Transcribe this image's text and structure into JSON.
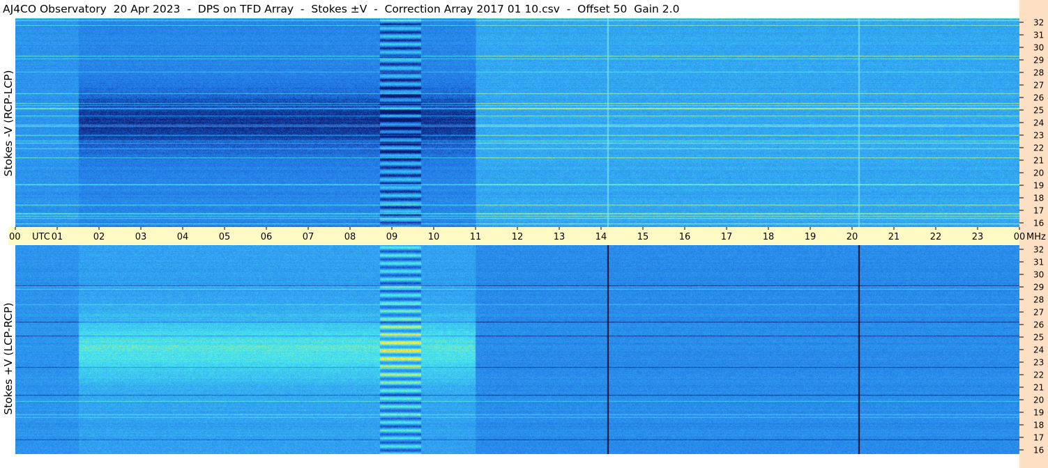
{
  "title": "AJ4CO Observatory  20 Apr 2023  -  DPS on TFD Array  -  Stokes ±V  -  Correction Array 2017 01 10.csv  -  Offset 50  Gain 2.0",
  "chart_data": [
    {
      "type": "heatmap",
      "panel": "top",
      "ylabel": "Stokes -V (RCP-LCP)",
      "x_ticks": [
        "00",
        "01",
        "02",
        "03",
        "04",
        "05",
        "06",
        "07",
        "08",
        "09",
        "10",
        "11",
        "12",
        "13",
        "14",
        "15",
        "16",
        "17",
        "18",
        "19",
        "20",
        "21",
        "22",
        "23",
        "00"
      ],
      "x_unit": "UTC",
      "xlim_hours": [
        0,
        24
      ],
      "y_ticks": [
        16,
        17,
        18,
        19,
        20,
        21,
        22,
        23,
        24,
        25,
        26,
        27,
        28,
        29,
        30,
        31,
        32
      ],
      "y_unit": "MHz",
      "ylim": [
        16,
        32
      ],
      "colormap": [
        "#0a1a6e",
        "#1f72e2",
        "#33a6f2",
        "#46e6ee",
        "#fff23a",
        "#ff5a1f"
      ]
    },
    {
      "type": "heatmap",
      "panel": "bottom",
      "ylabel": "Stokes +V (LCP-RCP)",
      "x_ticks": [
        "00",
        "01",
        "02",
        "03",
        "04",
        "05",
        "06",
        "07",
        "08",
        "09",
        "10",
        "11",
        "12",
        "13",
        "14",
        "15",
        "16",
        "17",
        "18",
        "19",
        "20",
        "21",
        "22",
        "23",
        "00"
      ],
      "x_unit": "UTC",
      "xlim_hours": [
        0,
        24
      ],
      "y_ticks": [
        16,
        17,
        18,
        19,
        20,
        21,
        22,
        23,
        24,
        25,
        26,
        27,
        28,
        29,
        30,
        31,
        32
      ],
      "y_unit": "MHz",
      "ylim": [
        16,
        32
      ],
      "colormap": [
        "#0a1a6e",
        "#1f72e2",
        "#33a6f2",
        "#46e6ee",
        "#fff23a",
        "#ff5a1f"
      ]
    }
  ]
}
